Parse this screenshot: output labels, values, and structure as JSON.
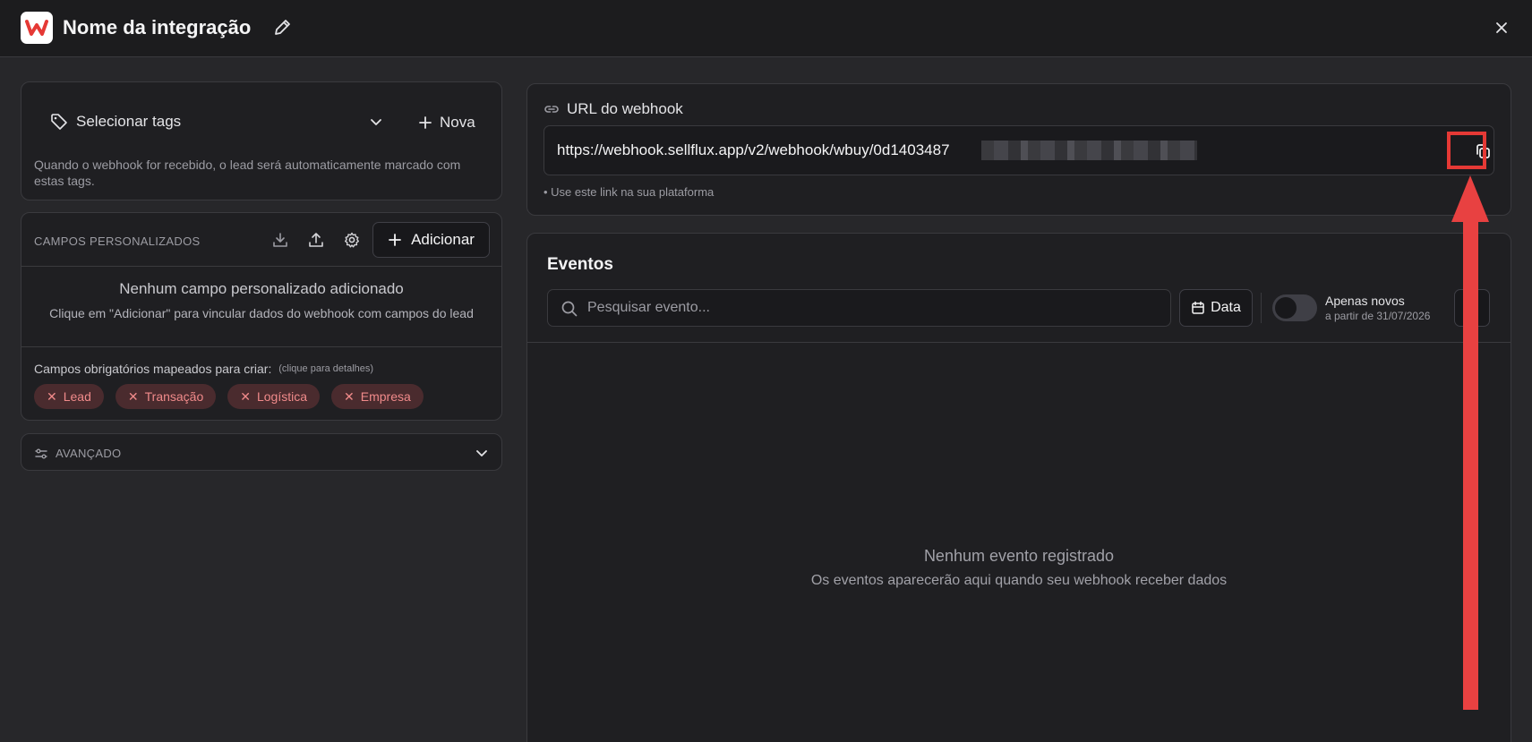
{
  "header": {
    "title": "Nome da integração",
    "logo_letter": "W",
    "logo_color": "#e53935"
  },
  "tags": {
    "select_label": "Selecionar tags",
    "new_label": "Nova",
    "help_text": "Quando o webhook for recebido, o lead será automaticamente marcado com estas tags."
  },
  "custom_fields": {
    "section_label": "CAMPOS PERSONALIZADOS",
    "add_label": "Adicionar",
    "empty_title": "Nenhum campo personalizado adicionado",
    "empty_sub": "Clique em \"Adicionar\" para vincular dados do webhook com campos do lead",
    "required_label": "Campos obrigatórios mapeados para criar:",
    "required_hint": "(clique para detalhes)",
    "required_chips": [
      "Lead",
      "Transação",
      "Logística",
      "Empresa"
    ]
  },
  "advanced": {
    "label": "AVANÇADO"
  },
  "webhook": {
    "label": "URL do webhook",
    "url_visible": "https://webhook.sellflux.app/v2/webhook/wbuy/0d1403487",
    "hint": "• Use este link na sua plataforma"
  },
  "events": {
    "title": "Eventos",
    "search_placeholder": "Pesquisar evento...",
    "date_label": "Data",
    "toggle_label": "Apenas novos",
    "toggle_sub": "a partir de 31/07/2026",
    "empty_title": "Nenhum evento registrado",
    "empty_sub": "Os eventos aparecerão aqui quando seu webhook receber dados"
  },
  "annotation": {
    "color": "#e53935"
  }
}
